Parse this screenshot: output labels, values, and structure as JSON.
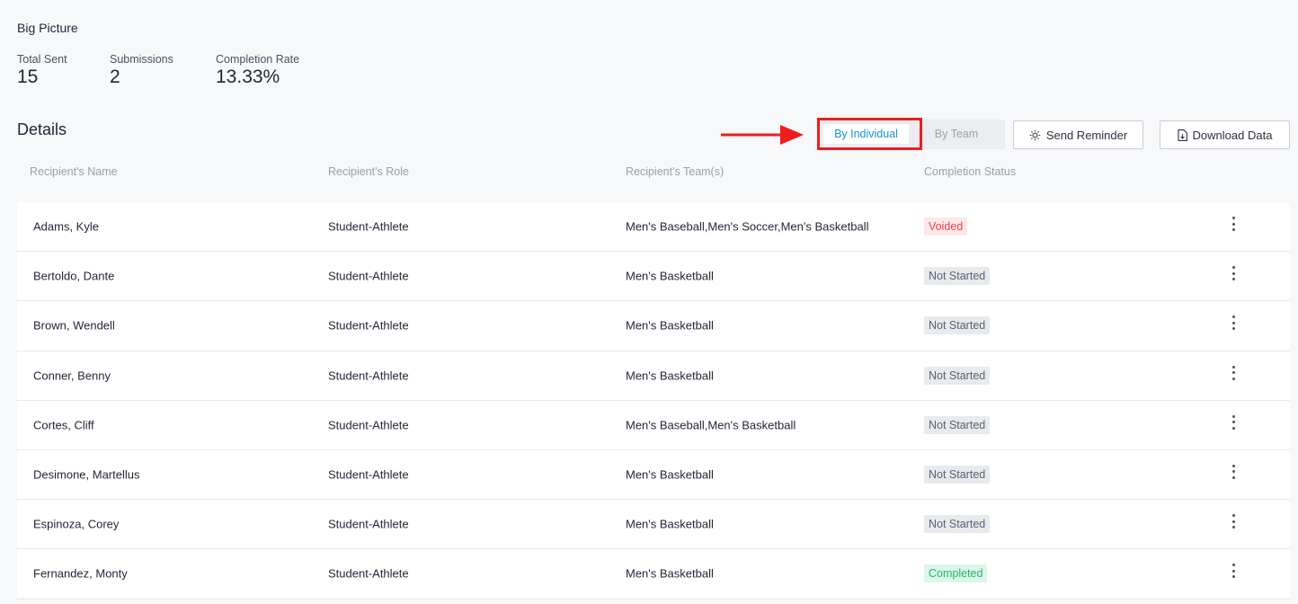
{
  "big_picture": {
    "title": "Big Picture",
    "metrics": [
      {
        "label": "Total Sent",
        "value": "15"
      },
      {
        "label": "Submissions",
        "value": "2"
      },
      {
        "label": "Completion Rate",
        "value": "13.33%"
      }
    ]
  },
  "details": {
    "title": "Details",
    "toggle": {
      "individual": "By Individual",
      "team": "By Team",
      "active": "individual"
    },
    "buttons": {
      "reminder": "Send Reminder",
      "download": "Download Data"
    }
  },
  "table": {
    "headers": [
      "Recipient's Name",
      "Recipient's Role",
      "Recipient's Team(s)",
      "Completion Status"
    ],
    "rows": [
      {
        "name": "Adams, Kyle",
        "role": "Student-Athlete",
        "teams": "Men's Baseball,Men's Soccer,Men's Basketball",
        "status": "Voided"
      },
      {
        "name": "Bertoldo, Dante",
        "role": "Student-Athlete",
        "teams": "Men's Basketball",
        "status": "Not Started"
      },
      {
        "name": "Brown, Wendell",
        "role": "Student-Athlete",
        "teams": "Men's Basketball",
        "status": "Not Started"
      },
      {
        "name": "Conner, Benny",
        "role": "Student-Athlete",
        "teams": "Men's Basketball",
        "status": "Not Started"
      },
      {
        "name": "Cortes, Cliff",
        "role": "Student-Athlete",
        "teams": "Men's Baseball,Men's Basketball",
        "status": "Not Started"
      },
      {
        "name": "Desimone, Martellus",
        "role": "Student-Athlete",
        "teams": "Men's Basketball",
        "status": "Not Started"
      },
      {
        "name": "Espinoza, Corey",
        "role": "Student-Athlete",
        "teams": "Men's Basketball",
        "status": "Not Started"
      },
      {
        "name": "Fernandez, Monty",
        "role": "Student-Athlete",
        "teams": "Men's Basketball",
        "status": "Completed"
      }
    ]
  },
  "colors": {
    "accent": "#1596c6",
    "highlight": "#ee1d1d",
    "voided": "#e5484d",
    "completed": "#1fb675"
  }
}
